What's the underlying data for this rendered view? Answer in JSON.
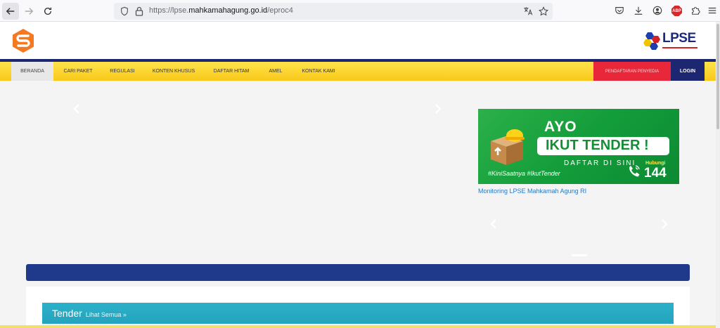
{
  "browser": {
    "url_prefix": "https://lpse.",
    "url_domain": "mahkamahagung.go.id",
    "url_path": "/eproc4",
    "abp_label": "ABP"
  },
  "logo": {
    "right_text": "LPSE"
  },
  "menu": {
    "items": [
      {
        "label": "BERANDA"
      },
      {
        "label": "CARI PAKET"
      },
      {
        "label": "REGULASI"
      },
      {
        "label": "KONTEN KHUSUS"
      },
      {
        "label": "DAFTAR HITAM"
      },
      {
        "label": "AMEL"
      },
      {
        "label": "KONTAK KAMI"
      }
    ],
    "register_label": "PENDAFTARAN PENYEDIA",
    "login_label": "LOGIN"
  },
  "banner": {
    "ayo": "AYO",
    "ikut": "IKUT TENDER !",
    "daftar": "DAFTAR DI SINI",
    "hashtag": "#KiniSaatnya #IkutTender",
    "hubungi": "Hubungi",
    "number": "144",
    "caption": "Monitoring LPSE Mahkamah Agung RI"
  },
  "tender": {
    "title": "Tender",
    "link": "Lihat Semua »"
  },
  "colors": {
    "menu_yellow": "#f9c91a",
    "navy": "#1d2670",
    "register_red": "#e8273a",
    "tender_teal": "#2cb1c9",
    "banner_green": "#139d3a"
  }
}
